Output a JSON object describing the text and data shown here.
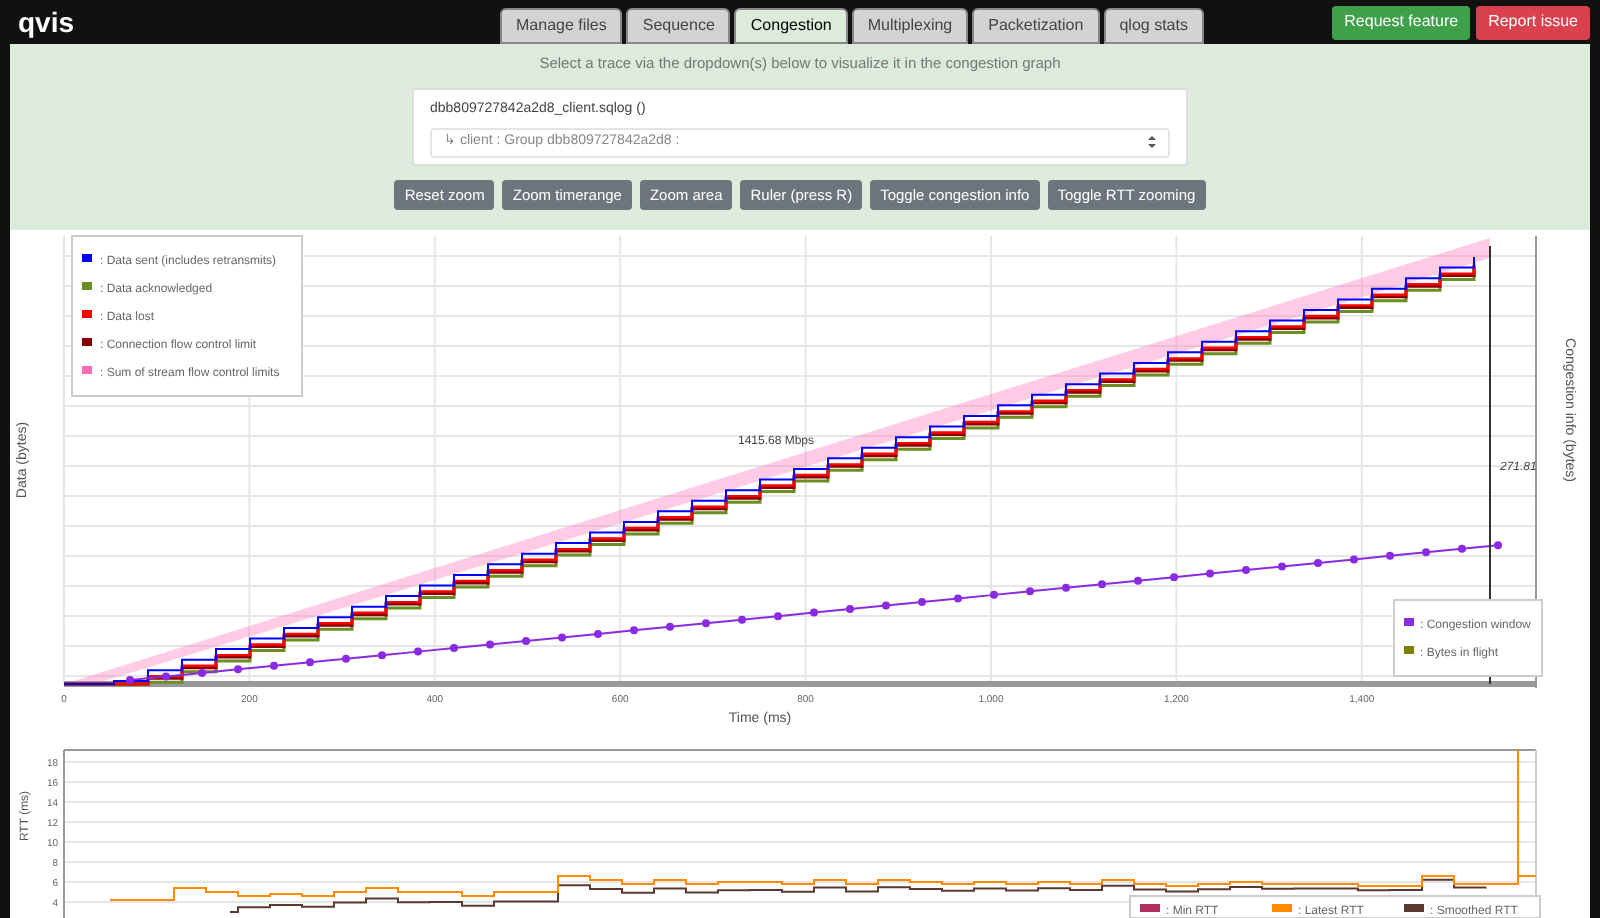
{
  "app": {
    "logo": "qvis"
  },
  "tabs": [
    {
      "label": "Manage files",
      "selected": false
    },
    {
      "label": "Sequence",
      "selected": false
    },
    {
      "label": "Congestion",
      "selected": true
    },
    {
      "label": "Multiplexing",
      "selected": false
    },
    {
      "label": "Packetization",
      "selected": false
    },
    {
      "label": "qlog stats",
      "selected": false
    }
  ],
  "header_buttons": [
    {
      "label": "Request feature",
      "kind": "success"
    },
    {
      "label": "Report issue",
      "kind": "danger"
    }
  ],
  "instructions": "Select a trace via the dropdown(s) below to visualize it in the congestion graph",
  "trace": {
    "file": "dbb809727842a2d8_client.sqlog ()",
    "select_value": "↳ client : Group dbb809727842a2d8 :"
  },
  "toolbar": [
    "Reset zoom",
    "Zoom timerange",
    "Zoom area",
    "Ruler (press R)",
    "Toggle congestion info",
    "Toggle RTT zooming"
  ],
  "main_chart": {
    "y_label": "Data (bytes)",
    "y2_label": "Congestion info (bytes)",
    "x_label": "Time (ms)",
    "x_ticks": [
      "0",
      "200",
      "400",
      "600",
      "800",
      "1,000",
      "1,200",
      "1,400"
    ],
    "legend": [
      {
        "label": ": Data sent (includes retransmits)",
        "color": "#0000ff"
      },
      {
        "label": ": Data acknowledged",
        "color": "#6b8e23"
      },
      {
        "label": ": Data lost",
        "color": "#ff0000"
      },
      {
        "label": ": Connection flow control limit",
        "color": "#8b0000"
      },
      {
        "label": ": Sum of stream flow control limits",
        "color": "#ff69b4"
      }
    ],
    "legend_right": [
      {
        "label": ": Congestion window",
        "color": "#8a2be2"
      },
      {
        "label": ": Bytes in flight",
        "color": "#808000"
      }
    ],
    "throughput": "1415.68 Mbps",
    "ruler_value": "271.81"
  },
  "rtt_chart": {
    "y_label": "RTT (ms)",
    "y_ticks": [
      "18",
      "16",
      "14",
      "12",
      "10",
      "8",
      "6",
      "4"
    ],
    "legend": [
      {
        "label": ": Min RTT",
        "color": "#b03060"
      },
      {
        "label": ": Latest RTT",
        "color": "#ff8c00"
      },
      {
        "label": ": Smoothed RTT",
        "color": "#5a3a30"
      }
    ]
  }
}
